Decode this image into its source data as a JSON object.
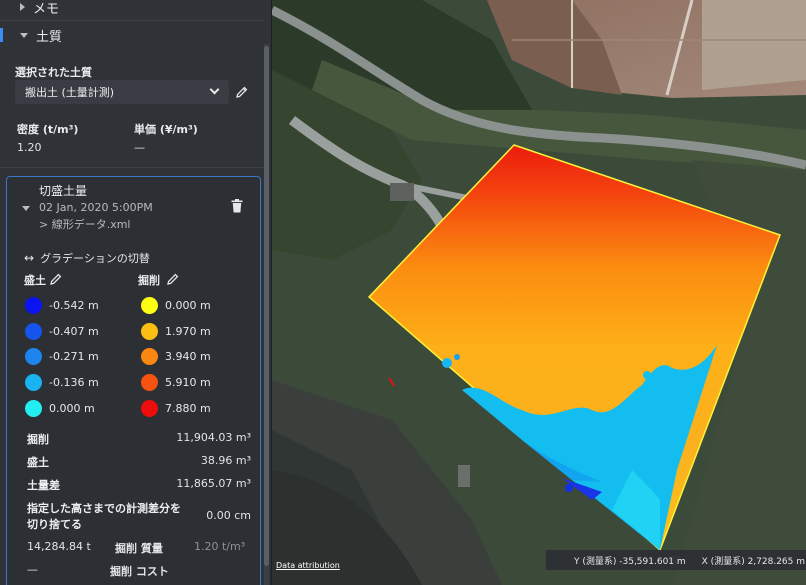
{
  "sidebar": {
    "memo_section": "メモ",
    "soil_section": "土質",
    "selected_soil_label": "選択された土質",
    "selected_soil_value": "搬出土 (土量計測)",
    "density_label": "密度 (t/m³)",
    "density_value": "1.20",
    "unit_price_label": "単価 (¥/m³)",
    "unit_price_value": "—"
  },
  "volume_card": {
    "title": "切盛土量",
    "datetime": "02 Jan, 2020 5:00PM",
    "source": "> 線形データ.xml",
    "gradient_toggle": "グラデーションの切替",
    "fill_heading": "盛土",
    "cut_heading": "掘削",
    "fill_legend": [
      {
        "color": "#0a14f0",
        "label": "-0.542 m"
      },
      {
        "color": "#1555ee",
        "label": "-0.407 m"
      },
      {
        "color": "#1e84ee",
        "label": "-0.271 m"
      },
      {
        "color": "#1ab2f0",
        "label": "-0.136 m"
      },
      {
        "color": "#22eef2",
        "label": "0.000 m"
      }
    ],
    "cut_legend": [
      {
        "color": "#fdfd14",
        "label": "0.000 m"
      },
      {
        "color": "#fbbf14",
        "label": "1.970 m"
      },
      {
        "color": "#f98712",
        "label": "3.940 m"
      },
      {
        "color": "#f5530f",
        "label": "5.910 m"
      },
      {
        "color": "#ef0c0c",
        "label": "7.880 m"
      }
    ],
    "stats": [
      {
        "label": "掘削",
        "value": "11,904.03 m³"
      },
      {
        "label": "盛土",
        "value": "38.96 m³"
      },
      {
        "label": "土量差",
        "value": "11,865.07 m³"
      }
    ],
    "threshold_label_line1": "指定した高さまでの計測差分を",
    "threshold_label_line2": "切り捨てる",
    "threshold_value": "0.00 cm",
    "mass_value": "14,284.84 t",
    "mass_label": "掘削 質量",
    "mass_unit": "1.20 t/m³",
    "cost_value": "—",
    "cost_label": "掘削 コスト"
  },
  "map": {
    "attribution": "Data attribution",
    "y_coord": "Y (測量系) -35,591.601 m",
    "x_coord": "X (測量系) 2,728.265 m"
  }
}
